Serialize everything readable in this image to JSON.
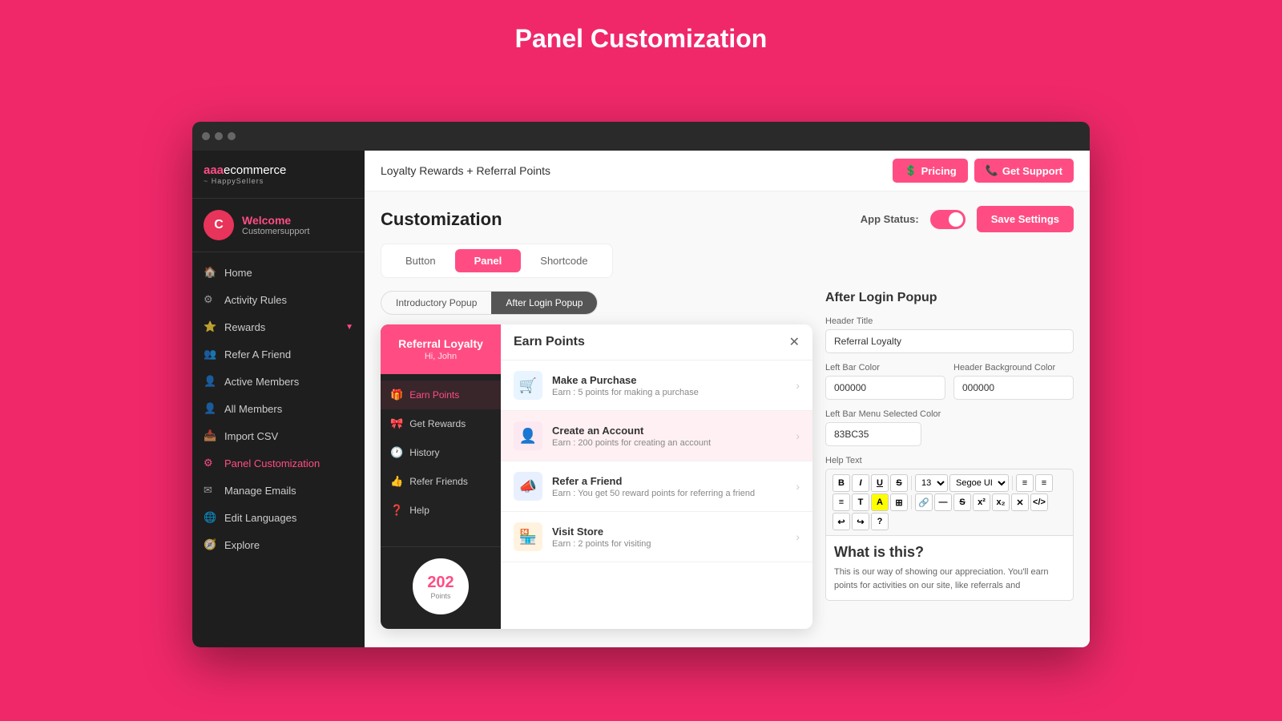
{
  "page": {
    "title": "Panel Customization"
  },
  "sidebar": {
    "logo": "aaaecommerce",
    "logo_sub": "HappySellers",
    "user": {
      "initial": "C",
      "name": "Welcome",
      "sub": "Customersupport"
    },
    "nav_items": [
      {
        "id": "home",
        "label": "Home",
        "icon": "🏠"
      },
      {
        "id": "activity-rules",
        "label": "Activity Rules",
        "icon": "⚙"
      },
      {
        "id": "rewards",
        "label": "Rewards",
        "icon": "⭐",
        "has_arrow": true
      },
      {
        "id": "refer-friend",
        "label": "Refer A Friend",
        "icon": "👥"
      },
      {
        "id": "active-members",
        "label": "Active Members",
        "icon": "👤"
      },
      {
        "id": "all-members",
        "label": "All Members",
        "icon": "👤"
      },
      {
        "id": "import-csv",
        "label": "Import CSV",
        "icon": "📥"
      },
      {
        "id": "panel-customization",
        "label": "Panel Customization",
        "icon": "⚙",
        "active": true
      },
      {
        "id": "manage-emails",
        "label": "Manage Emails",
        "icon": "✉"
      },
      {
        "id": "edit-languages",
        "label": "Edit Languages",
        "icon": "🌐"
      },
      {
        "id": "explore",
        "label": "Explore",
        "icon": "🧭"
      }
    ]
  },
  "header": {
    "app_name": "Loyalty Rewards + Referral Points",
    "pricing_label": "Pricing",
    "support_label": "Get Support"
  },
  "content": {
    "title": "Customization",
    "app_status_label": "App Status:",
    "save_button": "Save Settings",
    "tabs": [
      {
        "id": "button",
        "label": "Button"
      },
      {
        "id": "panel",
        "label": "Panel",
        "active": true
      },
      {
        "id": "shortcode",
        "label": "Shortcode"
      }
    ]
  },
  "popup_tabs": [
    {
      "id": "introductory",
      "label": "Introductory Popup"
    },
    {
      "id": "after-login",
      "label": "After Login Popup",
      "active": true
    }
  ],
  "loyalty_panel": {
    "header_title": "Referral Loyalty",
    "header_sub": "Hi, John",
    "menu_items": [
      {
        "id": "earn-points",
        "label": "Earn Points",
        "icon": "🎁",
        "active": true
      },
      {
        "id": "get-rewards",
        "label": "Get Rewards",
        "icon": "🎀"
      },
      {
        "id": "history",
        "label": "History",
        "icon": "🕐"
      },
      {
        "id": "refer-friends",
        "label": "Refer Friends",
        "icon": "👍"
      },
      {
        "id": "help",
        "label": "Help",
        "icon": "❓"
      }
    ],
    "points_value": "202",
    "points_label": "Points"
  },
  "panel_main": {
    "title": "Earn Points",
    "items": [
      {
        "id": "make-purchase",
        "title": "Make a Purchase",
        "sub": "Earn : 5 points for making a purchase",
        "icon": "🛒",
        "highlighted": false
      },
      {
        "id": "create-account",
        "title": "Create an Account",
        "sub": "Earn : 200 points for creating an account",
        "icon": "👤",
        "highlighted": true
      },
      {
        "id": "refer-friend",
        "title": "Refer a Friend",
        "sub": "Earn : You get 50 reward points for referring a friend",
        "icon": "📣",
        "highlighted": false
      },
      {
        "id": "visit-store",
        "title": "Visit Store",
        "sub": "Earn : 2 points for visiting",
        "icon": "🏪",
        "highlighted": false
      }
    ]
  },
  "right_panel": {
    "title": "After Login Popup",
    "header_title_label": "Header Title",
    "header_title_value": "Referral Loyalty",
    "left_bar_color_label": "Left Bar Color",
    "left_bar_color_value": "000000",
    "header_bg_color_label": "Header Background Color",
    "header_bg_color_value": "000000",
    "left_bar_menu_selected_label": "Left Bar Menu Selected Color",
    "left_bar_menu_selected_value": "83BC35",
    "help_text_label": "Help Text",
    "editor_title": "What is this?",
    "editor_text": "This is our way of showing our appreciation. You'll earn points for activities on our site, like referrals and",
    "toolbar_buttons": [
      "B",
      "I",
      "U",
      "S",
      "13",
      "Segoe UI"
    ]
  }
}
